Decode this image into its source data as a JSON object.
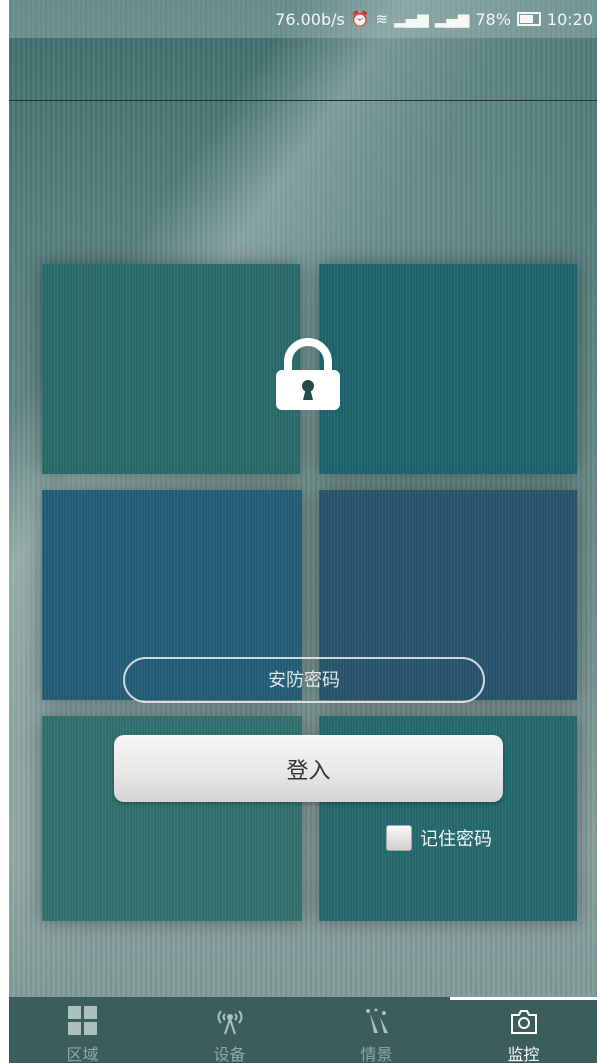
{
  "status_bar": {
    "speed": "76.00b/s",
    "battery": "78%",
    "time": "10:20"
  },
  "password_field": {
    "placeholder": "安防密码",
    "value": ""
  },
  "login_button": {
    "label": "登入"
  },
  "remember": {
    "label": "记住密码",
    "checked": false
  },
  "tabs": [
    {
      "label": "区域",
      "icon": "grid-icon",
      "active": false
    },
    {
      "label": "设备",
      "icon": "antenna-icon",
      "active": false
    },
    {
      "label": "情景",
      "icon": "scene-icon",
      "active": false
    },
    {
      "label": "监控",
      "icon": "camera-icon",
      "active": true
    }
  ],
  "colors": {
    "tab_bar": "#3c5e5a",
    "panel_teal": "#2c6d6e",
    "panel_blue": "#26607a"
  }
}
